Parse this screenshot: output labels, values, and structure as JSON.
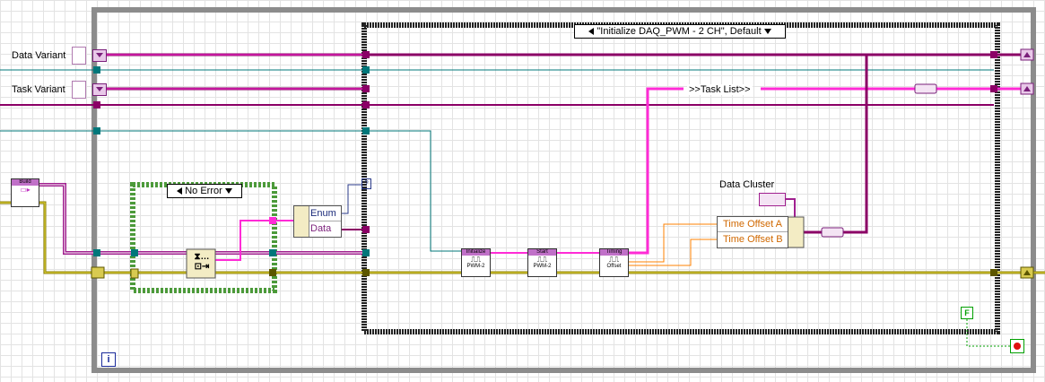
{
  "controls": {
    "data_variant_label": "Data Variant",
    "task_variant_label": "Task Variant"
  },
  "build_node": {
    "label": "Build"
  },
  "error_case": {
    "selector": "No Error"
  },
  "unbundle": {
    "rows": [
      "Enum",
      "Data"
    ]
  },
  "main_case": {
    "selector": "\"Initialize DAQ_PWM - 2 CH\", Default"
  },
  "task_list": {
    "text": ">>Task List>>"
  },
  "daq_nodes": [
    {
      "header": "Initialize",
      "glyph": "⎍⎍",
      "caption": "PWM-2"
    },
    {
      "header": "Start",
      "glyph": "⎍⎍",
      "caption": "PWM-2"
    },
    {
      "header": "Timing",
      "glyph": "⎍⎍",
      "caption": "Offset"
    }
  ],
  "data_cluster": {
    "label": "Data Cluster",
    "fields": [
      "Time Offset A",
      "Time Offset B"
    ]
  },
  "loop": {
    "iteration_terminal": "i",
    "stop_constant": "F"
  },
  "colors": {
    "variant": "#a0208f",
    "cluster": "#8b0066",
    "error": "#b3a600",
    "refnum": "#00777a",
    "dbl": "#ff8000",
    "boolean": "#00a000",
    "string_pink": "#ff2bd6"
  }
}
